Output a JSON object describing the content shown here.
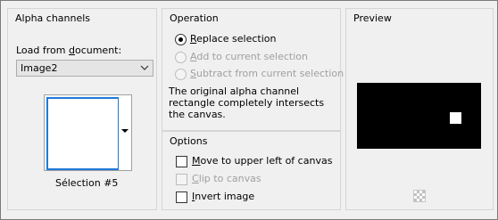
{
  "alpha": {
    "title": "Alpha channels",
    "load_label_prefix": "Load from ",
    "load_label_accel": "d",
    "load_label_suffix": "ocument:",
    "document_value": "Image2",
    "selection_name": "Sélection #5"
  },
  "operation": {
    "title": "Operation",
    "replace": {
      "accel": "R",
      "rest": "eplace selection",
      "checked": true,
      "enabled": true
    },
    "add": {
      "accel": "A",
      "rest": "dd to current selection",
      "checked": false,
      "enabled": false
    },
    "subtract": {
      "accel": "S",
      "rest": "ubtract from current selection",
      "checked": false,
      "enabled": false
    },
    "description": "The original alpha channel rectangle completely intersects the canvas."
  },
  "options": {
    "title": "Options",
    "move": {
      "accel": "M",
      "rest": "ove to upper left of canvas",
      "checked": false,
      "enabled": true
    },
    "clip": {
      "accel": "C",
      "rest": "lip to canvas",
      "checked": false,
      "enabled": false
    },
    "invert": {
      "accel": "I",
      "rest": "nvert image",
      "checked": false,
      "enabled": true
    }
  },
  "preview": {
    "title": "Preview"
  },
  "colors": {
    "accent": "#1e7ad8",
    "preview_bg": "#000000"
  }
}
